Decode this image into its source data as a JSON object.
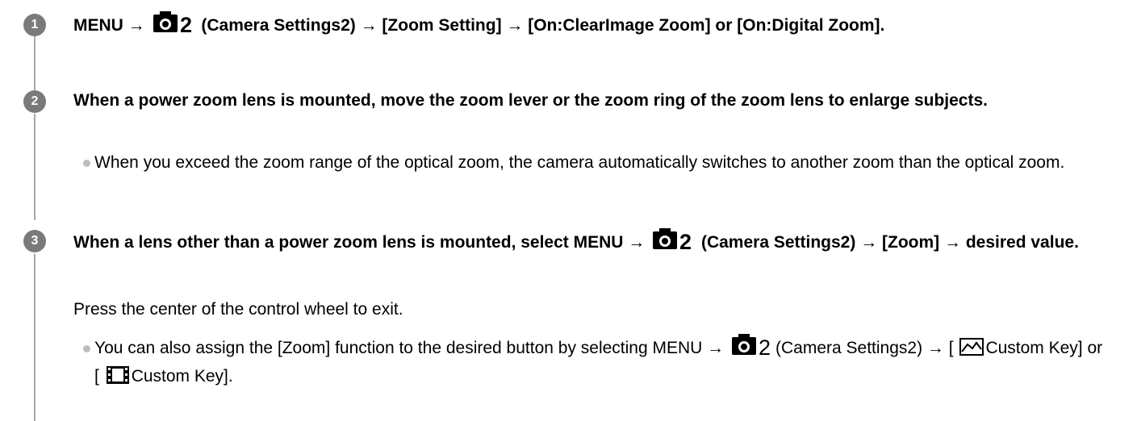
{
  "steps": [
    {
      "number": "1",
      "title_parts": [
        "MENU →",
        "(Camera Settings2) → [Zoom Setting] → [On:ClearImage Zoom] or [On:Digital Zoom]."
      ]
    },
    {
      "number": "2",
      "title": "When a power zoom lens is mounted, move the zoom lever or the zoom ring of the zoom lens to enlarge subjects.",
      "bullets": [
        "When you exceed the zoom range of the optical zoom, the camera automatically switches to another zoom than the optical zoom."
      ]
    },
    {
      "number": "3",
      "title_parts": [
        "When a lens other than a power zoom lens is mounted, select MENU →",
        "(Camera Settings2) → [Zoom] → desired value."
      ],
      "description": "Press the center of the control wheel to exit.",
      "bullet_parts": [
        "You can also assign the [Zoom] function to the desired button by selecting MENU →",
        "(Camera Settings2) → [",
        "Custom Key] or [",
        "Custom Key]."
      ]
    }
  ],
  "icons": {
    "camera_settings_page": "2"
  },
  "colors": {
    "step_circle": "#7a7a7a",
    "step_line": "#a8a8a8",
    "bullet": "#bdbdbd"
  }
}
